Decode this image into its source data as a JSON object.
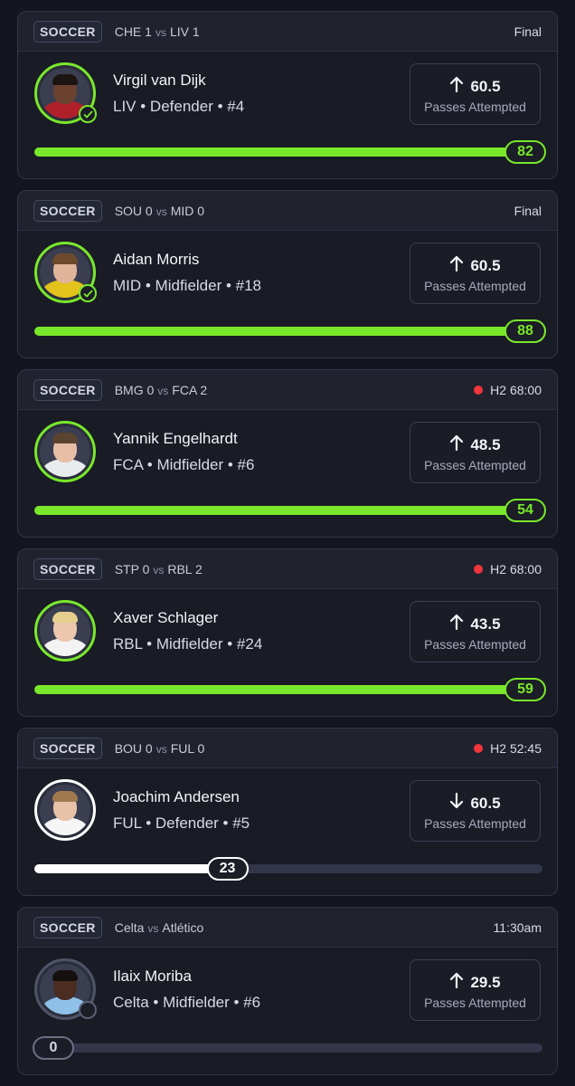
{
  "colors": {
    "accent_green": "#79e82b",
    "live_red": "#f0353c",
    "background": "#14151e",
    "card": "#1d1f2a"
  },
  "cards": [
    {
      "sport": "SOCCER",
      "home": "CHE 1",
      "vs": "vs",
      "away": "LIV 1",
      "status": "Final",
      "live": false,
      "player_name": "Virgil van Dijk",
      "player_meta": "LIV • Defender • #4",
      "direction_icon": "arrow-up-icon",
      "line_value": "60.5",
      "line_label": "Passes Attempted",
      "progress_value": "82",
      "progress_fraction": 1.0,
      "theme": "green",
      "badge": "check-icon",
      "shirt_color": "#b0202a",
      "skin_color": "#6b4230",
      "hair_color": "#1c1410"
    },
    {
      "sport": "SOCCER",
      "home": "SOU 0",
      "vs": "vs",
      "away": "MID 0",
      "status": "Final",
      "live": false,
      "player_name": "Aidan Morris",
      "player_meta": "MID • Midfielder • #18",
      "direction_icon": "arrow-up-icon",
      "line_value": "60.5",
      "line_label": "Passes Attempted",
      "progress_value": "88",
      "progress_fraction": 1.0,
      "theme": "green",
      "badge": "check-icon",
      "shirt_color": "#e2c21b",
      "skin_color": "#e0b49a",
      "hair_color": "#6e4a2c"
    },
    {
      "sport": "SOCCER",
      "home": "BMG 0",
      "vs": "vs",
      "away": "FCA 2",
      "status": "H2 68:00",
      "live": true,
      "player_name": "Yannik Engelhardt",
      "player_meta": "FCA • Midfielder • #6",
      "direction_icon": "arrow-up-icon",
      "line_value": "48.5",
      "line_label": "Passes Attempted",
      "progress_value": "54",
      "progress_fraction": 1.0,
      "theme": "green",
      "badge": "",
      "shirt_color": "#e9ecef",
      "skin_color": "#e6bea5",
      "hair_color": "#5a4330"
    },
    {
      "sport": "SOCCER",
      "home": "STP 0",
      "vs": "vs",
      "away": "RBL 2",
      "status": "H2 68:00",
      "live": true,
      "player_name": "Xaver Schlager",
      "player_meta": "RBL • Midfielder • #24",
      "direction_icon": "arrow-up-icon",
      "line_value": "43.5",
      "line_label": "Passes Attempted",
      "progress_value": "59",
      "progress_fraction": 1.0,
      "theme": "green",
      "badge": "",
      "shirt_color": "#f3f3f3",
      "skin_color": "#ecc6ad",
      "hair_color": "#e6cf8e"
    },
    {
      "sport": "SOCCER",
      "home": "BOU 0",
      "vs": "vs",
      "away": "FUL 0",
      "status": "H2 52:45",
      "live": true,
      "player_name": "Joachim Andersen",
      "player_meta": "FUL • Defender • #5",
      "direction_icon": "arrow-down-icon",
      "line_value": "60.5",
      "line_label": "Passes Attempted",
      "progress_value": "23",
      "progress_fraction": 0.38,
      "theme": "white",
      "badge": "",
      "shirt_color": "#f5f5f5",
      "skin_color": "#e8c2a8",
      "hair_color": "#a07a4e"
    },
    {
      "sport": "SOCCER",
      "home": "Celta",
      "vs": "vs",
      "away": "Atlético",
      "status": "11:30am",
      "live": false,
      "player_name": "Ilaix Moriba",
      "player_meta": "Celta • Midfielder • #6",
      "direction_icon": "arrow-up-icon",
      "line_value": "29.5",
      "line_label": "Passes Attempted",
      "progress_value": "0",
      "progress_fraction": 0.0,
      "theme": "grey",
      "badge": "clock-icon",
      "shirt_color": "#8fc0e8",
      "skin_color": "#4a2c20",
      "hair_color": "#15100d"
    }
  ]
}
